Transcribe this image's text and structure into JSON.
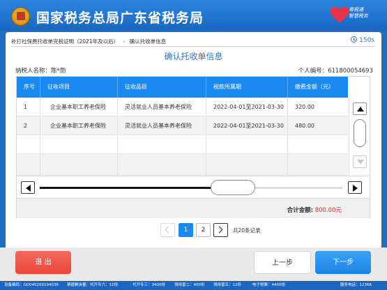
{
  "header": {
    "title": "国家税务总局广东省税务局",
    "logo_text": [
      "粤税通",
      "智慧税务"
    ]
  },
  "breadcrumb": {
    "service": "补打社保费托收单完税证明（2021年及以后）",
    "separator": "-",
    "step": "确认托收单信息"
  },
  "timer": {
    "value": "150s"
  },
  "page_title": "确认托收单信息",
  "taxpayer": {
    "label": "纳税人名称：",
    "name": "陈*勋"
  },
  "personal": {
    "label": "个人编号：",
    "number": "611800054693"
  },
  "table": {
    "columns": [
      "序号",
      "征收项目",
      "征收品目",
      "税款所属期",
      "缴费金额（元）"
    ],
    "rows": [
      [
        "1",
        "企业基本职工养老保险",
        "灵活就业人员基本养老保险",
        "2022-04-01至2021-03-30",
        "320.00"
      ],
      [
        "2",
        "企业基本职工养老保险",
        "灵活就业人员基本养老保险",
        "2022-04-01至2021-03-30",
        "480.00"
      ]
    ],
    "hscroll_position": 0.64
  },
  "total": {
    "label": "合计金额:",
    "value": "800.00",
    "unit": "元"
  },
  "pagination": {
    "pages": [
      "1",
      "2"
    ],
    "current": "1",
    "count_text": "共20条记录"
  },
  "buttons": {
    "exit": "退 出",
    "prev": "上一步",
    "next": "下一步"
  },
  "status_bar": [
    "设备编码：GD040200104036",
    "票据剩余量：代开专六：12份",
    "代开专三：3400份",
    "领用普二：400份",
    "领用普五：12份",
    "电子税票：4400份",
    "服务电话：12366"
  ]
}
